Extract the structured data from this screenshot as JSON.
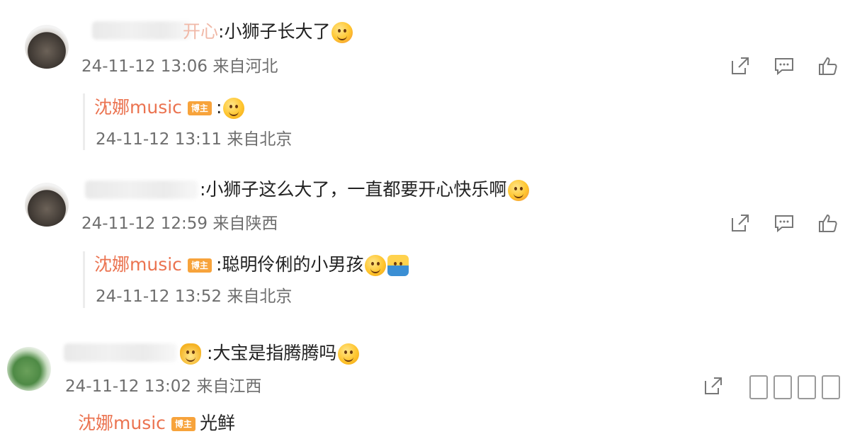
{
  "comments": [
    {
      "text": ":小狮子长大了",
      "name_fragment": "开心",
      "timestamp": "24-11-12 13:06",
      "location": "来自河北",
      "reply": {
        "author": "沈娜music",
        "badge": "博主",
        "text": ":",
        "timestamp": "24-11-12 13:11",
        "location": "来自北京"
      }
    },
    {
      "text": ":小狮子这么大了，一直都要开心快乐啊",
      "timestamp": "24-11-12 12:59",
      "location": "来自陕西",
      "reply": {
        "author": "沈娜music",
        "badge": "博主",
        "text": ":聪明伶俐的小男孩",
        "timestamp": "24-11-12 13:52",
        "location": "来自北京"
      }
    },
    {
      "text": ":大宝是指腾腾吗",
      "timestamp": "24-11-12 13:02",
      "location": "来自江西",
      "reply": {
        "author": "沈娜music",
        "badge": "博主",
        "text": "光鲜"
      }
    }
  ],
  "actions": {
    "share_icon": "share-icon",
    "comment_icon": "comment-icon",
    "like_icon": "thumbs-up-icon"
  },
  "colors": {
    "reply_name": "#eb7350",
    "badge": "#f7a33b",
    "meta": "#6e6e6e"
  }
}
